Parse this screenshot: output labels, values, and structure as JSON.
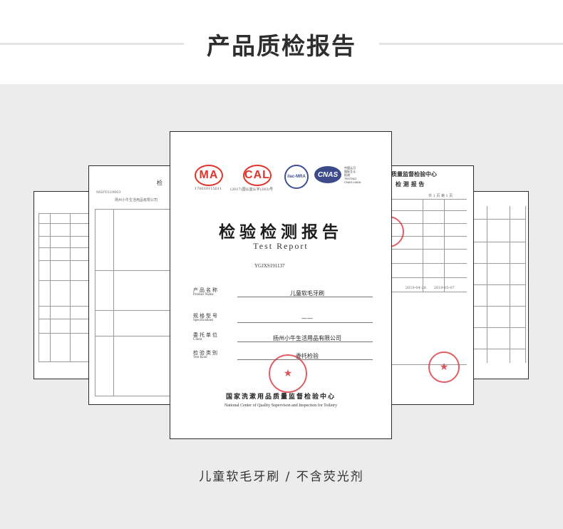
{
  "header": {
    "title": "产品质检报告"
  },
  "front_report": {
    "logos": {
      "ma": "MA",
      "cal": "CAL",
      "ilac": "ilac-MRA",
      "cnas": "CNAS",
      "cnas_text": "中国认可\n国际互认\n检测\nTESTING\nCNAS L6616"
    },
    "logo_numbers": [
      "170010115011",
      "(2017)国认监认字(283)号"
    ],
    "title": "检验检测报告",
    "subtitle": "Test  Report",
    "report_no": "YGJXS191137",
    "fields": [
      {
        "label_cn": "产品名称",
        "label_en": "Product Name",
        "value": "儿童软毛牙刷"
      },
      {
        "label_cn": "规格型号",
        "label_en": "Specifications",
        "value": "——"
      },
      {
        "label_cn": "委托单位",
        "label_en": "Client",
        "value": "扬州小牛生活用品有限公司"
      },
      {
        "label_cn": "检验类别",
        "label_en": "Test Kind",
        "value": "委托检验"
      }
    ],
    "org_cn": "国家洗漱用品质量监督检验中心",
    "org_en": "National Center of Quality Supervison and Inspection for Toiletry"
  },
  "right_report": {
    "title": "质量监督检验中心",
    "subtitle": "检 测 报 告",
    "page": "共 1 页 第 1 页",
    "dates": [
      "2019-04-28",
      "2019-05-07"
    ]
  },
  "left_report": {
    "title": "检 ",
    "code": "MSFYS19003",
    "company": "扬州小牛生活用品有限公司"
  },
  "caption": "儿童软毛牙刷 / 不含荧光剂"
}
